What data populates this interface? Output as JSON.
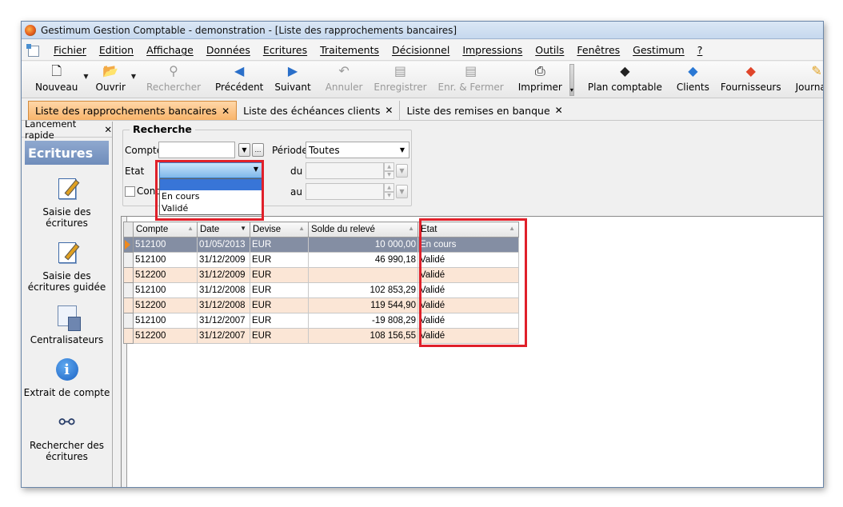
{
  "window": {
    "title": "Gestimum Gestion Comptable - demonstration - [Liste des rapprochements bancaires]"
  },
  "menu": [
    "Fichier",
    "Edition",
    "Affichage",
    "Données",
    "Ecritures",
    "Traitements",
    "Décisionnel",
    "Impressions",
    "Outils",
    "Fenêtres",
    "Gestimum",
    "?"
  ],
  "toolbar": {
    "nouveau": "Nouveau",
    "ouvrir": "Ouvrir",
    "rechercher": "Rechercher",
    "precedent": "Précédent",
    "suivant": "Suivant",
    "annuler": "Annuler",
    "enregistrer": "Enregistrer",
    "enr_fermer": "Enr. & Fermer",
    "imprimer": "Imprimer",
    "plan_comptable": "Plan comptable",
    "clients": "Clients",
    "fournisseurs": "Fournisseurs",
    "journaux": "Journaux"
  },
  "tabs": [
    "Liste des rapprochements bancaires",
    "Liste des échéances clients",
    "Liste des remises en banque"
  ],
  "tab_close": "✕",
  "side": {
    "header": "Lancement rapide",
    "close": "✕",
    "title": "Ecritures",
    "items": [
      "Saisie des écritures",
      "Saisie des écritures guidée",
      "Centralisateurs",
      "Extrait de compte",
      "Rechercher des écritures"
    ]
  },
  "search": {
    "title": "Recherche",
    "compte_label": "Compte",
    "periode_label": "Période",
    "periode_value": "Toutes",
    "etat_label": "Etat",
    "du_label": "du",
    "au_label": "au",
    "cont_label": "Cont",
    "etat_options": [
      "",
      "En cours",
      "Validé"
    ]
  },
  "grid": {
    "columns": [
      "Compte",
      "Date",
      "Devise",
      "Solde du relevé",
      "Etat"
    ],
    "rows": [
      [
        "512100",
        "01/05/2013",
        "EUR",
        "10 000,00",
        "En cours"
      ],
      [
        "512100",
        "31/12/2009",
        "EUR",
        "46 990,18",
        "Validé"
      ],
      [
        "512200",
        "31/12/2009",
        "EUR",
        "",
        "Validé"
      ],
      [
        "512100",
        "31/12/2008",
        "EUR",
        "102 853,29",
        "Validé"
      ],
      [
        "512200",
        "31/12/2008",
        "EUR",
        "119 544,90",
        "Validé"
      ],
      [
        "512100",
        "31/12/2007",
        "EUR",
        "-19 808,29",
        "Validé"
      ],
      [
        "512200",
        "31/12/2007",
        "EUR",
        "108 156,55",
        "Validé"
      ]
    ]
  },
  "colors": {
    "highlight": "#e0202a",
    "active_tab": "#f8b46b",
    "alt_row": "#fbe6d6",
    "selected_row": "#848ea3"
  }
}
